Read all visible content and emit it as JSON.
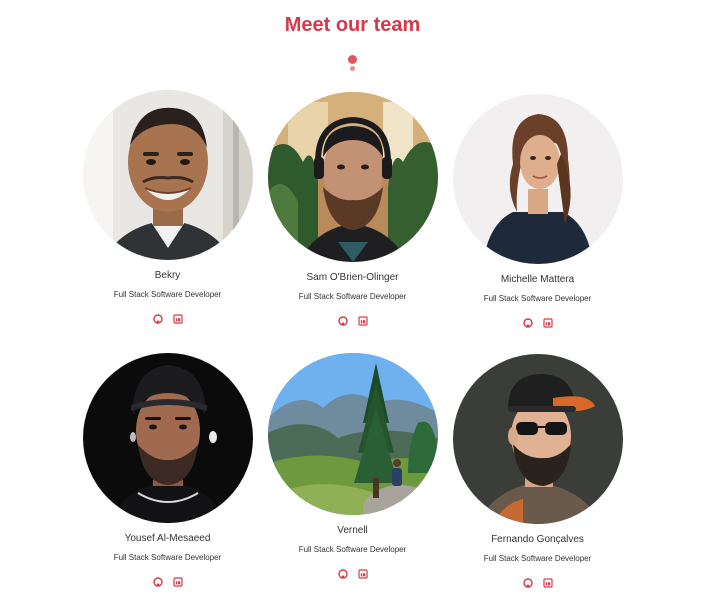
{
  "page": {
    "title": "Meet our team"
  },
  "colors": {
    "accent": "#d63a4a",
    "text": "#333333"
  },
  "team": [
    {
      "name": "Bekry",
      "role": "Full Stack Software Developer",
      "icons": [
        "github-icon",
        "linkedin-icon"
      ]
    },
    {
      "name": "Sam O'Brien-Olinger",
      "role": "Full Stack Software Developer",
      "icons": [
        "github-icon",
        "linkedin-icon"
      ]
    },
    {
      "name": "Michelle Mattera",
      "role": "Full Stack Software Developer",
      "icons": [
        "github-icon",
        "linkedin-icon"
      ]
    },
    {
      "name": "Yousef Al-Mesaeed",
      "role": "Full Stack Software Developer",
      "icons": [
        "github-icon",
        "linkedin-icon"
      ]
    },
    {
      "name": "Vernell",
      "role": "Full Stack Software Developer",
      "icons": [
        "github-icon",
        "linkedin-icon"
      ]
    },
    {
      "name": "Fernando Gonçalves",
      "role": "Full Stack Software Developer",
      "icons": [
        "github-icon",
        "linkedin-icon"
      ]
    }
  ]
}
